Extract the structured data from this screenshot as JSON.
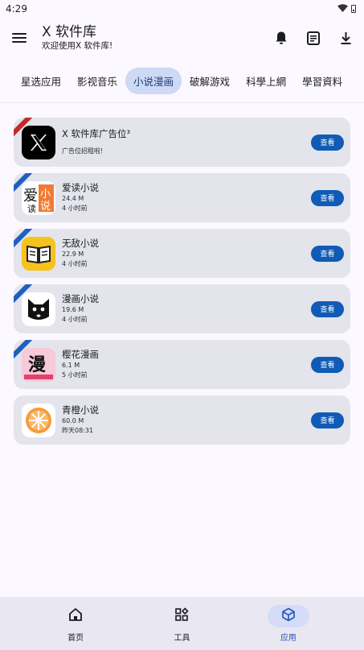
{
  "status_bar": {
    "time": "4:29"
  },
  "app_bar": {
    "title": "X 软件库",
    "subtitle": "欢迎使用X 软件库!"
  },
  "tabs": [
    {
      "label": "星选应用",
      "active": false
    },
    {
      "label": "影视音乐",
      "active": false
    },
    {
      "label": "小说漫画",
      "active": true
    },
    {
      "label": "破解游戏",
      "active": false
    },
    {
      "label": "科學上網",
      "active": false
    },
    {
      "label": "學習資料",
      "active": false
    }
  ],
  "apps": [
    {
      "name": "X 软件库广告位³",
      "size": "",
      "time": "广告位招租啦!",
      "ribbon": "red",
      "icon": "x-logo-icon",
      "button": "查看"
    },
    {
      "name": "爱读小说",
      "size": "24.4 M",
      "time": "4 小时前",
      "ribbon": "blue",
      "icon": "aidu-novel-icon",
      "button": "查看"
    },
    {
      "name": "无敌小说",
      "size": "22.9 M",
      "time": "4 小时前",
      "ribbon": "blue",
      "icon": "open-book-icon",
      "button": "查看"
    },
    {
      "name": "漫画小说",
      "size": "19.6 M",
      "time": "4 小时前",
      "ribbon": "blue",
      "icon": "cat-icon",
      "button": "查看"
    },
    {
      "name": "樱花漫画",
      "size": "6.1 M",
      "time": "5 小时前",
      "ribbon": "blue",
      "icon": "sakura-manga-icon",
      "button": "查看"
    },
    {
      "name": "青橙小说",
      "size": "60.0 M",
      "time": "昨天08:31",
      "ribbon": "none",
      "icon": "orange-slice-icon",
      "button": "查看"
    }
  ],
  "bottom_nav": [
    {
      "label": "首页",
      "icon": "home-icon",
      "active": false
    },
    {
      "label": "工具",
      "icon": "tools-grid-icon",
      "active": false
    },
    {
      "label": "应用",
      "icon": "cube-icon",
      "active": true
    }
  ],
  "colors": {
    "accent": "#0f5bb5",
    "active_tab": "#cdd9f5",
    "card_bg": "#e3e4ec",
    "ribbon_red": "#c62828",
    "ribbon_blue": "#1f5fbf"
  }
}
